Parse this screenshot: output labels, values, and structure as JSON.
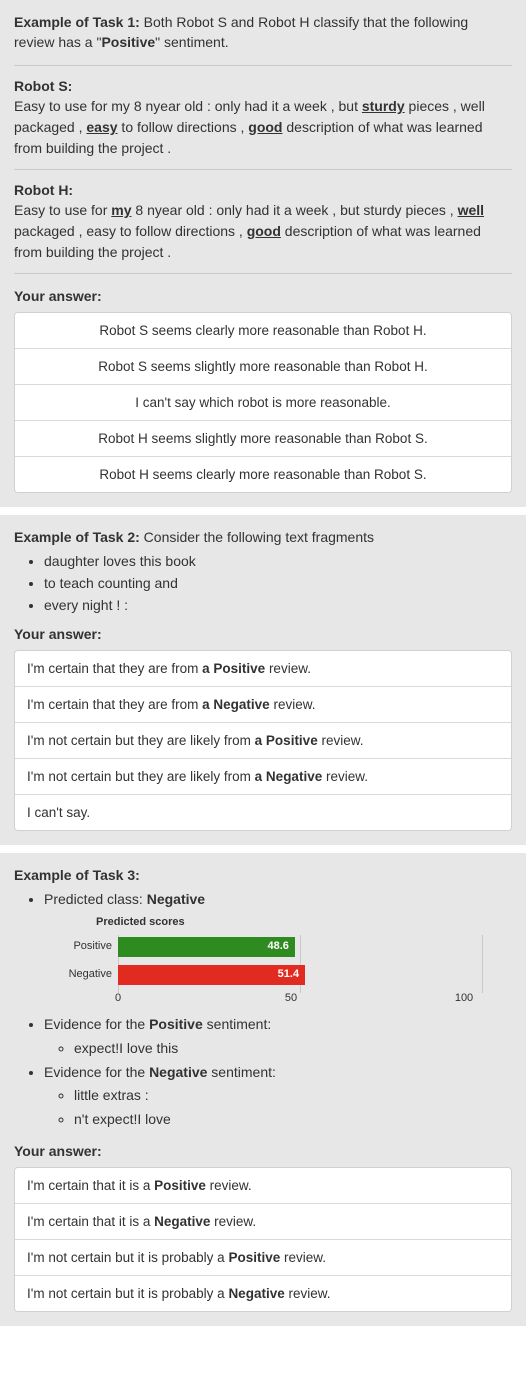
{
  "task1": {
    "heading": "Example of Task 1:",
    "intro_pre": " Both Robot S and Robot H classify that the following review has a \"",
    "intro_bold": "Positive",
    "intro_post": "\" sentiment.",
    "robotS_label": "Robot S:",
    "robotS_parts": {
      "p1": "Easy to use for my 8 nyear old : only had it a week , but ",
      "h1": "sturdy",
      "p2": " pieces , well packaged , ",
      "h2": "easy",
      "p3": " to follow directions , ",
      "h3": "good",
      "p4": " description of what was learned from building the project ."
    },
    "robotH_label": "Robot H:",
    "robotH_parts": {
      "p1": "Easy to use for ",
      "h1": "my",
      "p2": " 8 nyear old : only had it a week , but sturdy pieces , ",
      "h2": "well",
      "p3": " packaged , easy to follow directions , ",
      "h3": "good",
      "p4": " description of what was learned from building the project ."
    },
    "answer_head": "Your answer:",
    "options": [
      "Robot S seems clearly more reasonable than Robot H.",
      "Robot S seems slightly more reasonable than Robot H.",
      "I can't say which robot is more reasonable.",
      "Robot H seems slightly more reasonable than Robot S.",
      "Robot H seems clearly more reasonable than Robot S."
    ]
  },
  "task2": {
    "heading": "Example of Task 2:",
    "intro": " Consider the following text fragments",
    "fragments": [
      "daughter loves this book",
      "to teach counting and",
      "every night ! :"
    ],
    "answer_head": "Your answer:",
    "options": [
      {
        "pre": "I'm certain that they are from ",
        "bold": "a Positive",
        "post": " review."
      },
      {
        "pre": "I'm certain that they are from ",
        "bold": "a Negative",
        "post": " review."
      },
      {
        "pre": "I'm not certain but they are likely from ",
        "bold": "a Positive",
        "post": " review."
      },
      {
        "pre": "I'm not certain but they are likely from ",
        "bold": "a Negative",
        "post": " review."
      },
      {
        "pre": "I can't say.",
        "bold": "",
        "post": ""
      }
    ]
  },
  "task3": {
    "heading": "Example of Task 3:",
    "predicted_label": "Predicted class: ",
    "predicted_value": "Negative",
    "evidence_pos_label_pre": "Evidence for the ",
    "evidence_pos_label_bold": "Positive",
    "evidence_pos_label_post": " sentiment:",
    "evidence_pos": [
      "expect!I love this"
    ],
    "evidence_neg_label_pre": "Evidence for the ",
    "evidence_neg_label_bold": "Negative",
    "evidence_neg_label_post": " sentiment:",
    "evidence_neg": [
      "little extras :",
      "n't expect!I love"
    ],
    "answer_head": "Your answer:",
    "options": [
      {
        "pre": "I'm certain that it is a ",
        "bold": "Positive",
        "post": " review."
      },
      {
        "pre": "I'm certain that it is a ",
        "bold": "Negative",
        "post": " review."
      },
      {
        "pre": "I'm not certain but it is probably a ",
        "bold": "Positive",
        "post": " review."
      },
      {
        "pre": "I'm not certain but it is probably a ",
        "bold": "Negative",
        "post": " review."
      }
    ]
  },
  "chart_data": {
    "type": "bar",
    "title": "Predicted scores",
    "orientation": "horizontal",
    "categories": [
      "Positive",
      "Negative"
    ],
    "values": [
      48.6,
      51.4
    ],
    "colors": [
      "#2e8b1f",
      "#e22b20"
    ],
    "xlabel": "",
    "ylabel": "",
    "xlim": [
      0,
      100
    ],
    "ticks": [
      0,
      50,
      100
    ]
  }
}
